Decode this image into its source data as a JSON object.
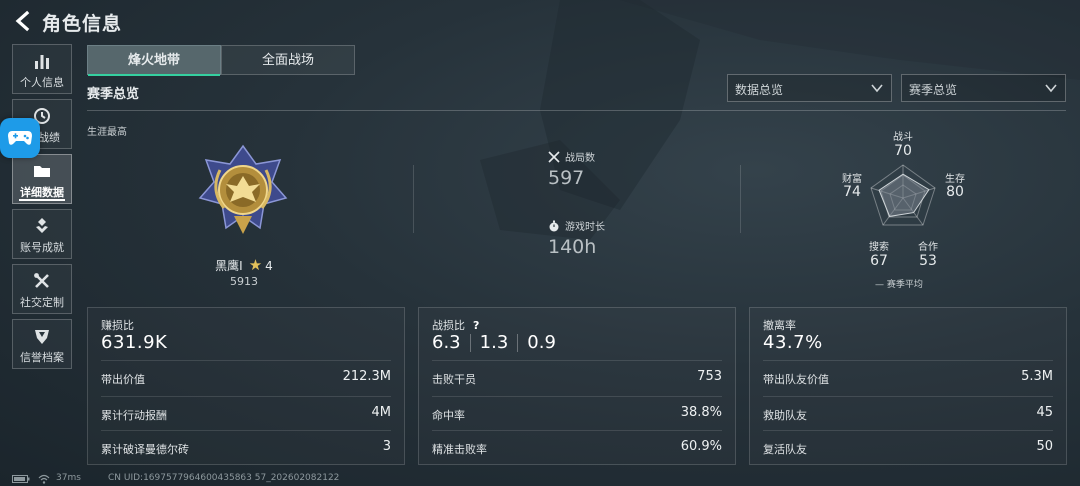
{
  "header": {
    "title": "角色信息"
  },
  "sidebar": {
    "items": [
      {
        "label": "个人信息",
        "icon": "bar-chart-icon"
      },
      {
        "label": "战绩",
        "icon": "history-icon"
      },
      {
        "label": "详细数据",
        "icon": "folder-icon",
        "active": true
      },
      {
        "label": "账号成就",
        "icon": "achievement-icon"
      },
      {
        "label": "社交定制",
        "icon": "tools-icon"
      },
      {
        "label": "信誉档案",
        "icon": "reputation-icon"
      }
    ]
  },
  "tabs": [
    {
      "label": "烽火地带",
      "active": true
    },
    {
      "label": "全面战场",
      "active": false
    }
  ],
  "section_title": "赛季总览",
  "dropdowns": {
    "data": {
      "value": "数据总览"
    },
    "season": {
      "value": "赛季总览"
    }
  },
  "overview": {
    "career_label": "生涯最高",
    "rank": {
      "name": "黑鹰I",
      "stars": "4",
      "score": "5913"
    },
    "matches": {
      "label": "战局数",
      "value": "597"
    },
    "playtime": {
      "label": "游戏时长",
      "value": "140h"
    }
  },
  "radar": {
    "axes": [
      {
        "label": "战斗",
        "value": "70"
      },
      {
        "label": "生存",
        "value": "80"
      },
      {
        "label": "合作",
        "value": "53"
      },
      {
        "label": "搜索",
        "value": "67"
      },
      {
        "label": "财富",
        "value": "74"
      }
    ],
    "legend": "赛季平均"
  },
  "panels": {
    "profit": {
      "caption": "赚损比",
      "value": "631.9K",
      "rows": [
        {
          "label": "带出价值",
          "value": "212.3M"
        },
        {
          "label": "累计行动报酬",
          "value": "4M"
        },
        {
          "label": "累计破译曼德尔砖",
          "value": "3"
        }
      ]
    },
    "kd": {
      "caption": "战损比",
      "values": [
        "6.3",
        "1.3",
        "0.9"
      ],
      "help": "?",
      "rows": [
        {
          "label": "击败干员",
          "value": "753"
        },
        {
          "label": "命中率",
          "value": "38.8%"
        },
        {
          "label": "精准击败率",
          "value": "60.9%"
        }
      ]
    },
    "extract": {
      "caption": "撤离率",
      "value": "43.7%",
      "rows": [
        {
          "label": "带出队友价值",
          "value": "5.3M"
        },
        {
          "label": "救助队友",
          "value": "45"
        },
        {
          "label": "复活队友",
          "value": "50"
        }
      ]
    }
  },
  "footer": {
    "ping": "37ms",
    "uid": "CN UID:1697577964600435863 57_202602082122"
  },
  "colors": {
    "accent": "#35d0a0",
    "float_button": "#1e9be8",
    "star": "#e2c05a"
  }
}
